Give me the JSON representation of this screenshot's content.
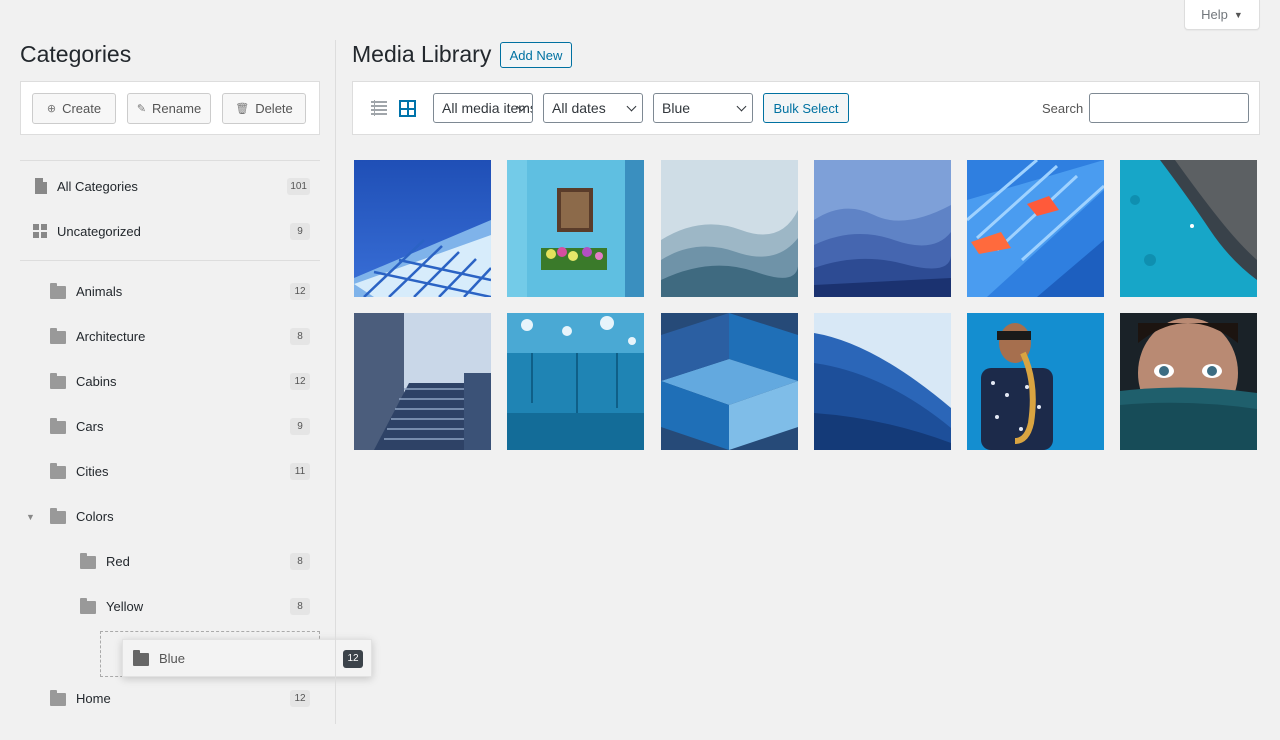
{
  "help": {
    "label": "Help"
  },
  "sidebar": {
    "title": "Categories",
    "actions": {
      "create": "Create",
      "rename": "Rename",
      "delete": "Delete"
    },
    "items": [
      {
        "label": "All Categories",
        "count": "101"
      },
      {
        "label": "Uncategorized",
        "count": "9"
      },
      {
        "label": "Animals",
        "count": "12"
      },
      {
        "label": "Architecture",
        "count": "8"
      },
      {
        "label": "Cabins",
        "count": "12"
      },
      {
        "label": "Cars",
        "count": "9"
      },
      {
        "label": "Cities",
        "count": "11"
      },
      {
        "label": "Colors",
        "count": ""
      },
      {
        "label": "Red",
        "count": "8"
      },
      {
        "label": "Yellow",
        "count": "8"
      },
      {
        "label": "Home",
        "count": "12"
      }
    ],
    "drag_item": {
      "label": "Blue",
      "count": "12"
    }
  },
  "main": {
    "title": "Media Library",
    "add_new": "Add New",
    "filters": {
      "type": "All media items",
      "date": "All dates",
      "category": "Blue"
    },
    "bulk_select": "Bulk Select",
    "search_label": "Search",
    "search_value": ""
  },
  "colors": {
    "accent": "#0071a1",
    "background": "#f1f1f1"
  },
  "icons": {
    "view_list": "list-view-icon",
    "view_grid": "grid-view-icon",
    "create": "plus-circle-icon",
    "rename": "pencil-icon",
    "delete": "trash-icon",
    "folder": "folder-icon",
    "all": "page-icon",
    "uncategorized": "grid-icon"
  }
}
